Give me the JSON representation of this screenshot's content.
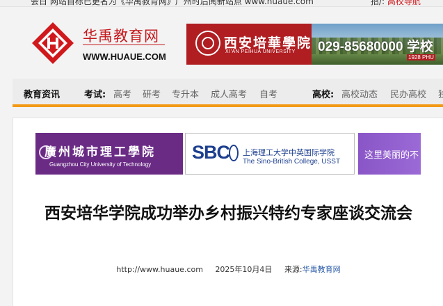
{
  "topbar": {
    "left_text": "会日  网站目标已更名为《华禹教育网》广州时后阅新站点  www.huaue.com",
    "right_prefix": "招/:",
    "right_link": "高校导航"
  },
  "header": {
    "logo_cn": "华禹教育网",
    "logo_en": "WWW.HUAUE.COM",
    "banner": {
      "name": "西安培華學院",
      "name_en": "XI'AN PEIHUA UNIVERSITY",
      "phone": "029-85680000 学校",
      "badge": "1928 PHU"
    }
  },
  "nav": {
    "section_title": "教育资讯",
    "exam_label": "考试:",
    "exam_links": [
      "高考",
      "研考",
      "专升本",
      "成人高考",
      "自考"
    ],
    "school_label": "高校:",
    "school_links": [
      "高校动态",
      "民办高校",
      "独"
    ]
  },
  "ads": {
    "gz": {
      "cn": "廣州城市理工學院",
      "en": "Guangzhou City University of Technology"
    },
    "sbc": {
      "logo": "SBC",
      "cn": "上海理工大学中英国际学院",
      "en": "The Sino-British College, USST"
    },
    "beauty": {
      "text": "这里美丽的不"
    }
  },
  "article": {
    "title": "西安培华学院成功举办乡村振兴特约专家座谈交流会",
    "url": "http://www.huaue.com",
    "date": "2025年10月4日",
    "source_label": "来源:",
    "source_name": "华禹教育网"
  },
  "colors": {
    "brand_red": "#c5191d",
    "nav_accent": "#f29a16",
    "banner_red": "#b01e22",
    "ad_purple": "#6a2b85",
    "link_blue": "#2a5ba8"
  }
}
